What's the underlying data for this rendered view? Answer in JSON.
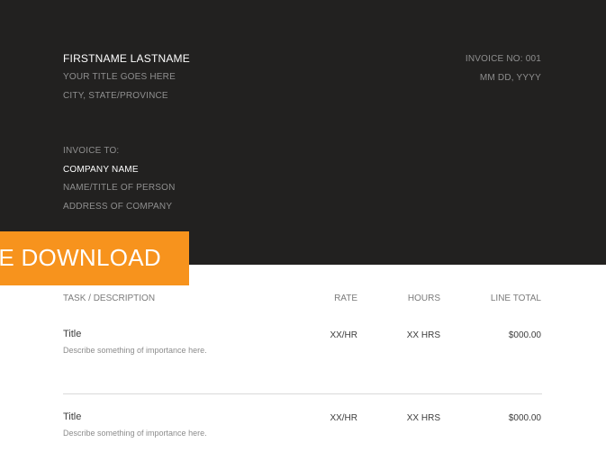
{
  "sender": {
    "name": "FIRSTNAME LASTNAME",
    "title": "YOUR TITLE GOES HERE",
    "location": "CITY, STATE/PROVINCE"
  },
  "invoice": {
    "number_label": "INVOICE NO: 001",
    "date": "MM DD, YYYY"
  },
  "recipient": {
    "label": "INVOICE TO:",
    "company": "COMPANY NAME",
    "person": "NAME/TITLE OF PERSON",
    "address": "ADDRESS OF COMPANY"
  },
  "banner": {
    "text": "EE DOWNLOAD",
    "color": "#f7931d"
  },
  "table": {
    "headers": {
      "task": "TASK / DESCRIPTION",
      "rate": "RATE",
      "hours": "HOURS",
      "total": "LINE TOTAL"
    },
    "rows": [
      {
        "title": "Title",
        "description": "Describe something of importance here.",
        "rate": "XX/HR",
        "hours": "XX HRS",
        "total": "$000.00"
      },
      {
        "title": "Title",
        "description": "Describe something of importance here.",
        "rate": "XX/HR",
        "hours": "XX HRS",
        "total": "$000.00"
      }
    ]
  },
  "colors": {
    "header_bg": "#222120",
    "accent": "#f7931d"
  }
}
